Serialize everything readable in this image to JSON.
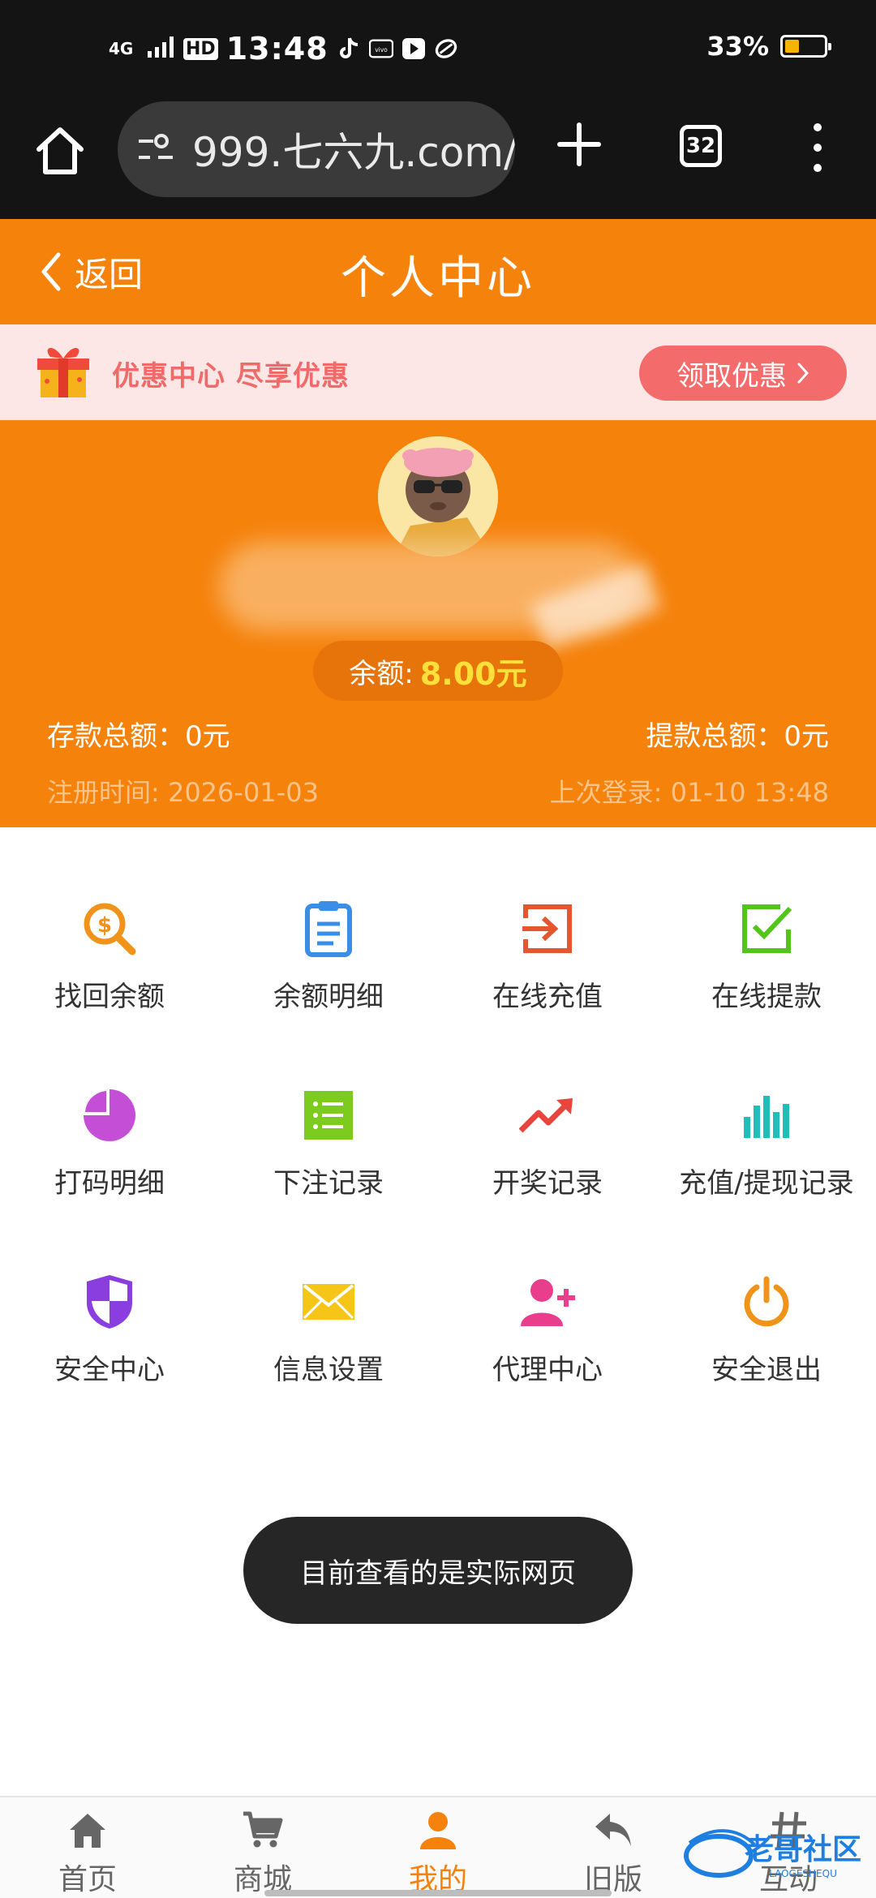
{
  "status_bar": {
    "network": "4G",
    "hd": "HD",
    "time": "13:48",
    "battery_text": "33%",
    "battery_level": 0.33,
    "vivo_label": "vivo"
  },
  "browser": {
    "url": "999.七六九.com/",
    "tab_count": "32"
  },
  "header": {
    "back_label": "返回",
    "title": "个人中心"
  },
  "promo": {
    "text": "优惠中心 尽享优惠",
    "button_label": "领取优惠"
  },
  "profile": {
    "balance_label": "余额:",
    "balance_value": "8.00元",
    "deposit_total": "存款总额：0元",
    "withdraw_total": "提款总额：0元",
    "register_time": "注册时间: 2026-01-03",
    "last_login": "上次登录: 01-10 13:48"
  },
  "menu": [
    {
      "label": "找回余额",
      "icon": "search-money-icon",
      "color": "#f0931a"
    },
    {
      "label": "余额明细",
      "icon": "clipboard-icon",
      "color": "#3a8ee6"
    },
    {
      "label": "在线充值",
      "icon": "login-box-icon",
      "color": "#e4572e"
    },
    {
      "label": "在线提款",
      "icon": "checkbox-icon",
      "color": "#52c41a"
    },
    {
      "label": "打码明细",
      "icon": "pie-chart-icon",
      "color": "#c44fd6"
    },
    {
      "label": "下注记录",
      "icon": "list-icon",
      "color": "#7ecb20"
    },
    {
      "label": "开奖记录",
      "icon": "trending-up-icon",
      "color": "#e8453c"
    },
    {
      "label": "充值/提现记录",
      "icon": "bar-chart-icon",
      "color": "#1fbfb8"
    },
    {
      "label": "安全中心",
      "icon": "shield-icon",
      "color": "#8a3ee0"
    },
    {
      "label": "信息设置",
      "icon": "envelope-icon",
      "color": "#f5c518"
    },
    {
      "label": "代理中心",
      "icon": "add-user-icon",
      "color": "#e83e8c"
    },
    {
      "label": "安全退出",
      "icon": "power-icon",
      "color": "#f0931a"
    }
  ],
  "toast": "目前查看的是实际网页",
  "nav": [
    {
      "label": "首页",
      "icon": "home-icon"
    },
    {
      "label": "商城",
      "icon": "cart-icon"
    },
    {
      "label": "我的",
      "icon": "user-icon"
    },
    {
      "label": "旧版",
      "icon": "reply-icon"
    },
    {
      "label": "互动",
      "icon": "hash-icon"
    }
  ],
  "watermark": {
    "text": "老哥社区",
    "sub": "LAOGESHEQU"
  },
  "colors": {
    "brand": "#f5820b",
    "promo_bg": "#fde6e6",
    "promo_btn": "#f36b6b",
    "balance_value": "#ffe03a"
  }
}
